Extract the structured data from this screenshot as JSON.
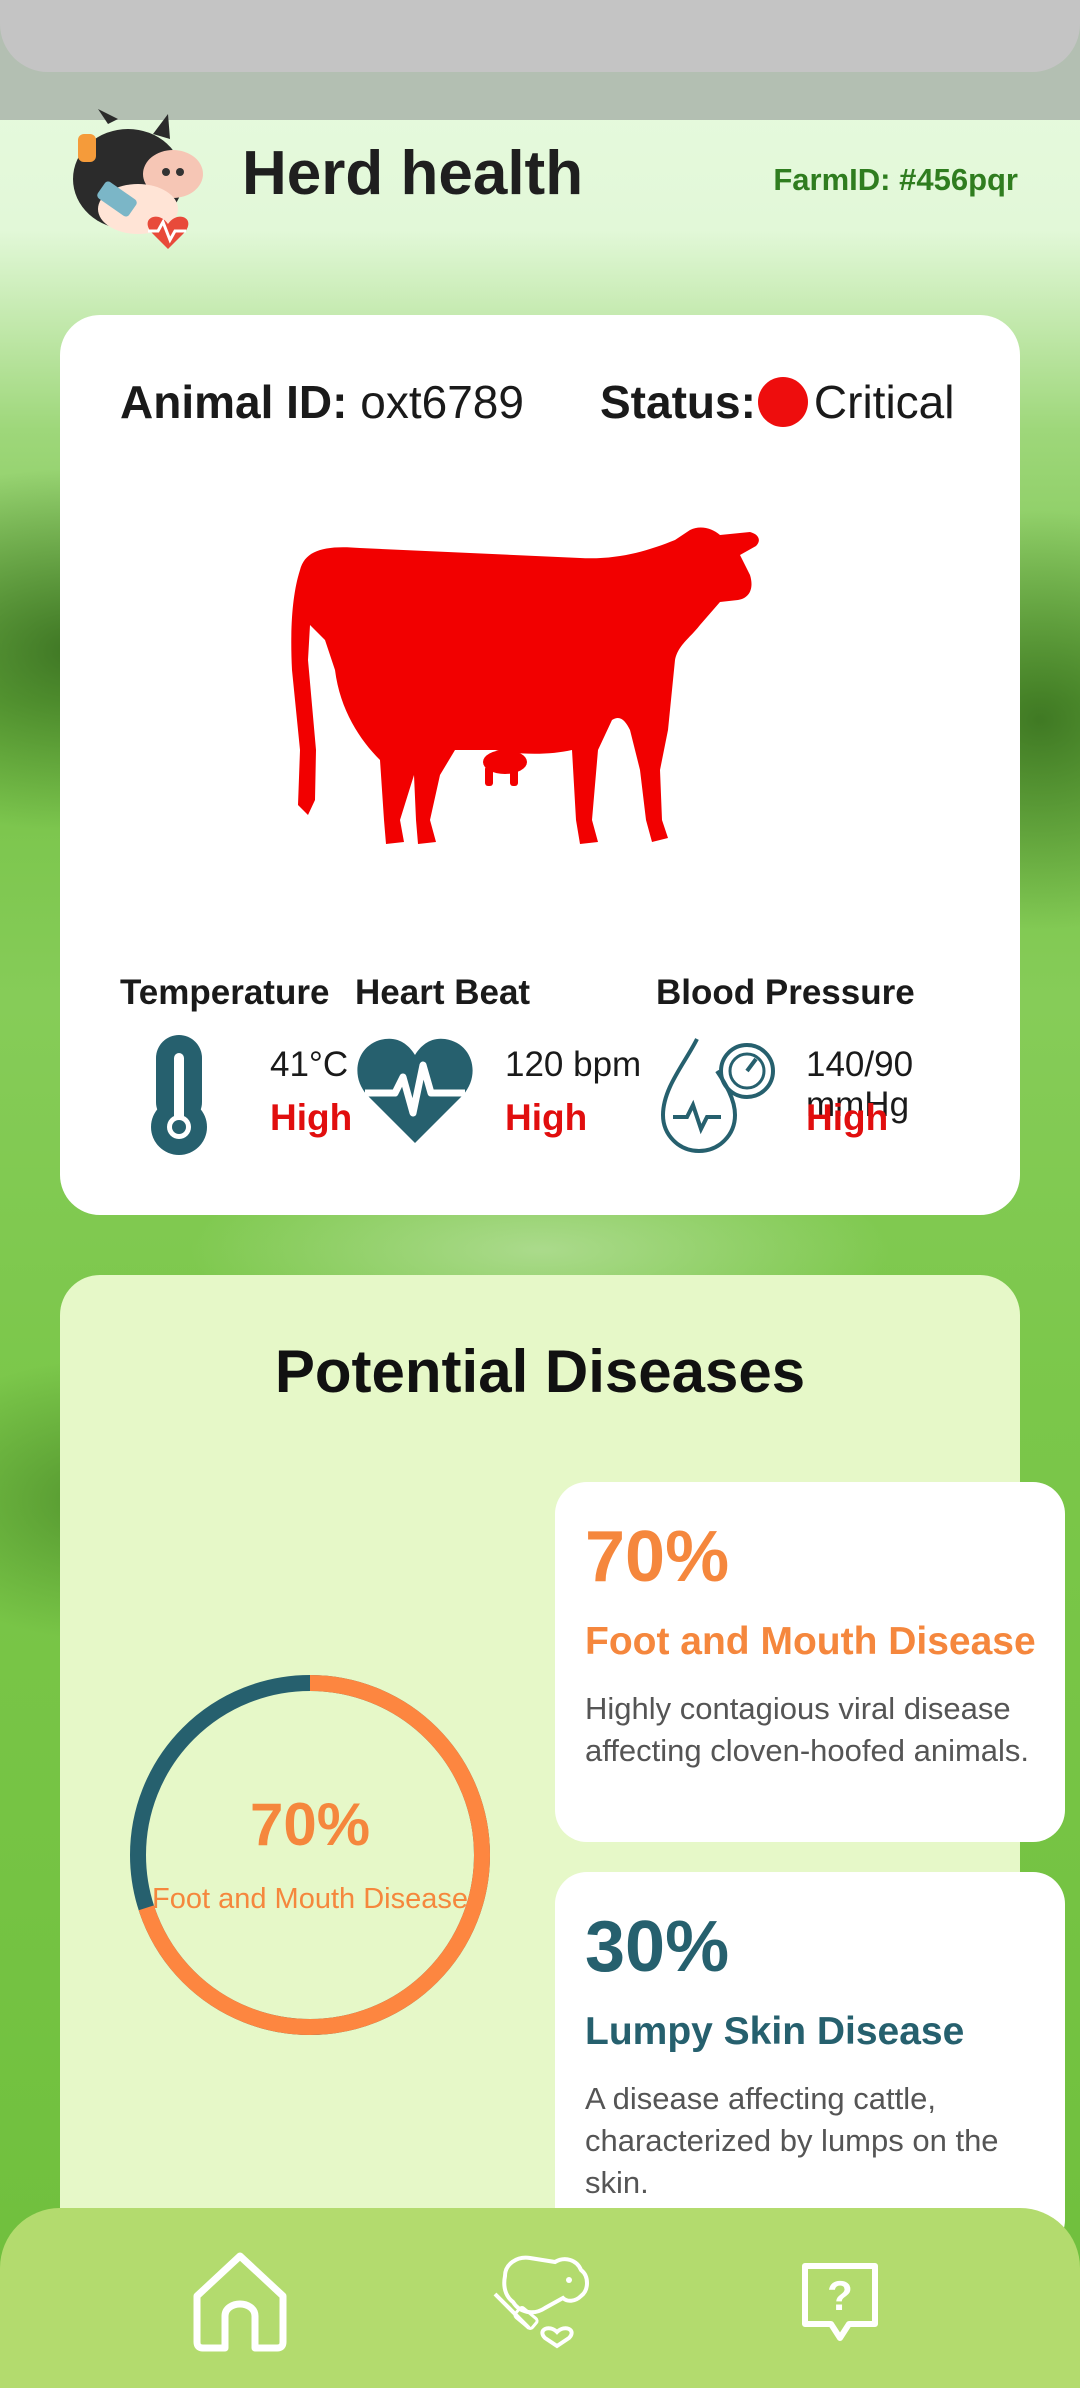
{
  "header": {
    "title": "Herd health",
    "farm_id": "FarmID: #456pqr"
  },
  "animal": {
    "id_label": "Animal ID:",
    "id_value": "oxt6789",
    "status_label": "Status:",
    "status_value": "Critical",
    "status_color": "#ee0d0d",
    "silhouette_color": "#f20000"
  },
  "vitals": [
    {
      "label": "Temperature",
      "value": "41°C",
      "level": "High",
      "icon": "thermometer-icon"
    },
    {
      "label": "Heart Beat",
      "value": "120 bpm",
      "level": "High",
      "icon": "heart-pulse-icon"
    },
    {
      "label": "Blood Pressure",
      "value": "140/90 mmHg",
      "level": "High",
      "icon": "blood-pressure-icon"
    }
  ],
  "diseases": {
    "title": "Potential Diseases",
    "donut": {
      "center_value": "70%",
      "center_label": "Foot and Mouth Disease",
      "primary_fraction": 0.7,
      "primary_color": "#fd8640",
      "secondary_color": "#26606e"
    },
    "items": [
      {
        "percent": "70%",
        "name": "Foot and Mouth Disease",
        "description": "Highly contagious viral disease affecting cloven-hoofed animals.",
        "color": "#f5873d"
      },
      {
        "percent": "30%",
        "name": "Lumpy Skin Disease",
        "description": "A disease affecting cattle, characterized by lumps on the skin.",
        "color": "#26606e"
      }
    ]
  },
  "nav": [
    {
      "icon": "home-icon"
    },
    {
      "icon": "herd-health-icon"
    },
    {
      "icon": "help-icon"
    }
  ],
  "colors": {
    "accent_teal": "#26606e",
    "alert_red": "#e10e0e",
    "brand_green": "#2f7d1f",
    "nav_green": "#b3db6e"
  }
}
